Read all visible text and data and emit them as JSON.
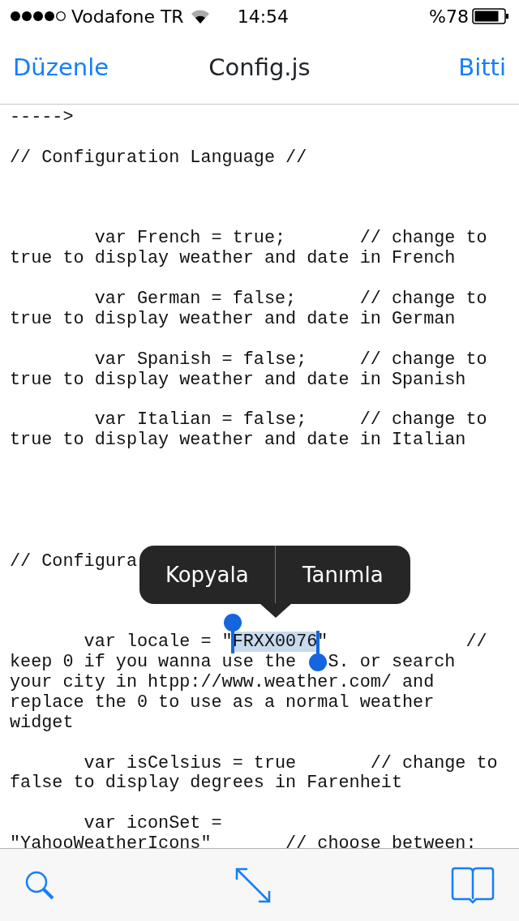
{
  "status_bar": {
    "carrier": "Vodafone TR",
    "time": "14:54",
    "battery": "%78"
  },
  "nav": {
    "left": "Düzenle",
    "title": "Config.js",
    "right": "Bitti"
  },
  "code_lines": [
    {
      "kind": "code",
      "text": "----->"
    },
    {
      "kind": "blank"
    },
    {
      "kind": "code",
      "text": "// Configuration Language //"
    },
    {
      "kind": "blank"
    },
    {
      "kind": "blank"
    },
    {
      "kind": "blank"
    },
    {
      "kind": "code",
      "text": "        var French = true;       // change to"
    },
    {
      "kind": "code",
      "text": "true to display weather and date in French"
    },
    {
      "kind": "blank"
    },
    {
      "kind": "code",
      "text": "        var German = false;      // change to"
    },
    {
      "kind": "code",
      "text": "true to display weather and date in German"
    },
    {
      "kind": "blank"
    },
    {
      "kind": "code",
      "text": "        var Spanish = false;     // change to"
    },
    {
      "kind": "code",
      "text": "true to display weather and date in Spanish"
    },
    {
      "kind": "blank"
    },
    {
      "kind": "code",
      "text": "        var Italian = false;     // change to"
    },
    {
      "kind": "code",
      "text": "true to display weather and date in Italian"
    },
    {
      "kind": "blank"
    },
    {
      "kind": "blank"
    },
    {
      "kind": "blank"
    },
    {
      "kind": "blank"
    },
    {
      "kind": "blank"
    },
    {
      "kind": "code",
      "text": "// Configura"
    },
    {
      "kind": "blank"
    },
    {
      "kind": "blank"
    },
    {
      "kind": "blank"
    },
    {
      "kind": "selection",
      "text": "       var locale = \"",
      "selection": "FRXX0076",
      "after": "\"             //"
    },
    {
      "kind": "code",
      "text": "keep 0 if you wanna use the   S. or search"
    },
    {
      "kind": "code",
      "text": "your city in htpp://www.weather.com/ and"
    },
    {
      "kind": "code",
      "text": "replace the 0 to use as a normal weather"
    },
    {
      "kind": "code",
      "text": "widget"
    },
    {
      "kind": "blank"
    },
    {
      "kind": "code",
      "text": "       var isCelsius = true       // change to"
    },
    {
      "kind": "code",
      "text": "false to display degrees in Farenheit"
    },
    {
      "kind": "blank"
    },
    {
      "kind": "code",
      "text": "       var iconSet ="
    },
    {
      "kind": "code",
      "text": "\"YahooWeatherIcons\"       // choose between:"
    }
  ],
  "menu": [
    "Kopyala",
    "Tanımla"
  ]
}
